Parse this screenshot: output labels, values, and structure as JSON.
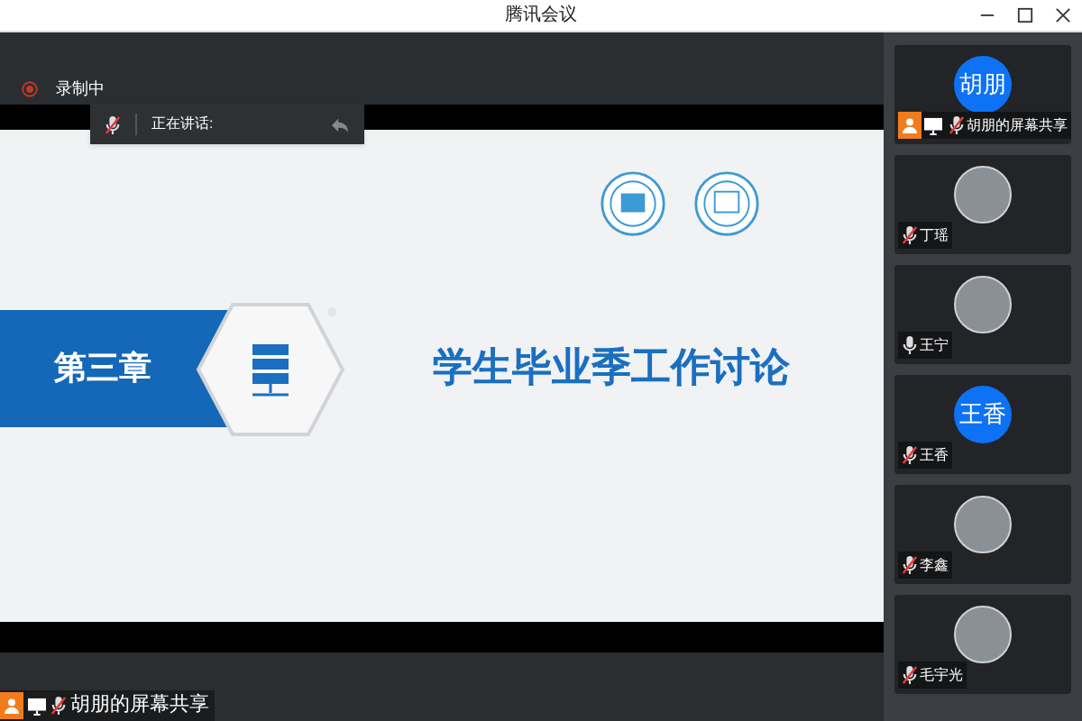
{
  "window": {
    "title": "腾讯会议"
  },
  "recording": {
    "label": "录制中"
  },
  "speaking_bar": {
    "label": "正在讲话:",
    "mic_muted": true
  },
  "slide": {
    "chapter": "第三章",
    "title": "学生毕业季工作讨论"
  },
  "share_label": {
    "text": "胡朋的屏幕共享",
    "mic_muted": true,
    "sharing": true
  },
  "participants": [
    {
      "name": "胡朋的屏幕共享",
      "kind": "initials",
      "avatar_text": "胡朋",
      "mic_muted": true,
      "sharing": true
    },
    {
      "name": "丁瑶",
      "kind": "photo",
      "mic_muted": true,
      "sharing": false
    },
    {
      "name": "王宁",
      "kind": "photo",
      "mic_muted": false,
      "sharing": false
    },
    {
      "name": "王香",
      "kind": "initials",
      "avatar_text": "王香",
      "mic_muted": true,
      "sharing": false
    },
    {
      "name": "李鑫",
      "kind": "photo",
      "mic_muted": true,
      "sharing": false
    },
    {
      "name": "毛宇光",
      "kind": "photo",
      "mic_muted": true,
      "sharing": false
    }
  ]
}
